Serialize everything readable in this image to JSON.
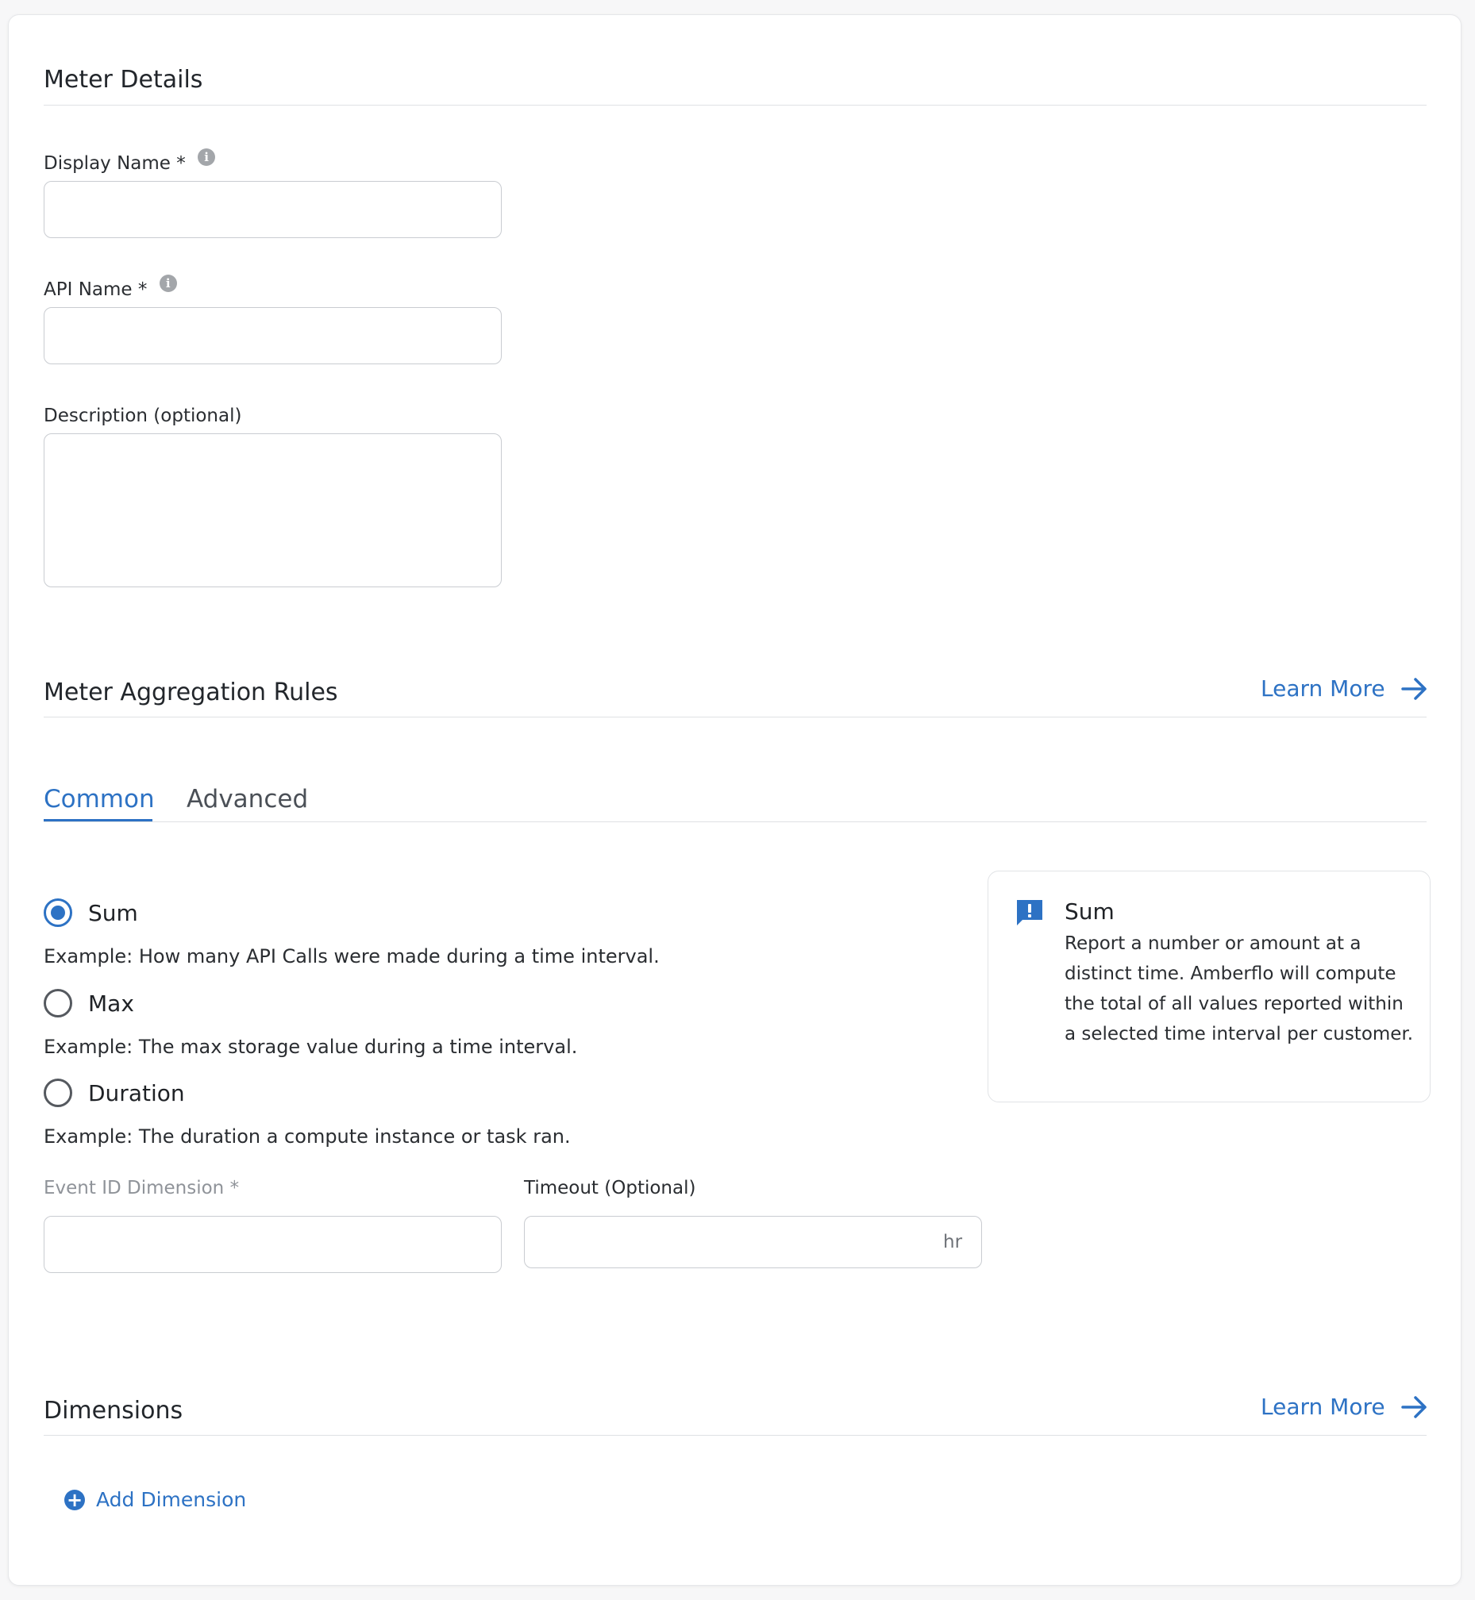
{
  "meter_details": {
    "title": "Meter Details",
    "display_name": {
      "label": "Display Name",
      "required": "*",
      "info": "i",
      "value": "",
      "placeholder": ""
    },
    "api_name": {
      "label": "API Name",
      "required": "*",
      "info": "i",
      "value": "",
      "placeholder": ""
    },
    "description": {
      "label": "Description (optional)",
      "value": "",
      "placeholder": ""
    }
  },
  "aggregation": {
    "title": "Meter Aggregation Rules",
    "learn_more": "Learn More",
    "tabs": [
      {
        "label": "Common",
        "active": true
      },
      {
        "label": "Advanced",
        "active": false
      }
    ],
    "options": [
      {
        "label": "Sum",
        "example": "Example: How many API Calls were made during a time interval.",
        "checked": true
      },
      {
        "label": "Max",
        "example": "Example: The max storage value during a time interval.",
        "checked": false
      },
      {
        "label": "Duration",
        "example": "Example: The duration a compute instance or task ran.",
        "checked": false
      }
    ],
    "info_box": {
      "icon": "feedback-icon",
      "title": "Sum",
      "text": "Report a number or amount at a distinct time. Amberflo will compute the total of all values reported within a selected time interval per customer."
    },
    "event_id": {
      "label": "Event ID Dimension *",
      "value": ""
    },
    "timeout": {
      "label": "Timeout (Optional)",
      "value": "",
      "suffix": "hr"
    }
  },
  "dimensions": {
    "title": "Dimensions",
    "learn_more": "Learn More",
    "add_label": "Add Dimension"
  },
  "colors": {
    "accent": "#2d72c4",
    "border": "#c9ccd1",
    "divider": "#dfe1e4"
  }
}
